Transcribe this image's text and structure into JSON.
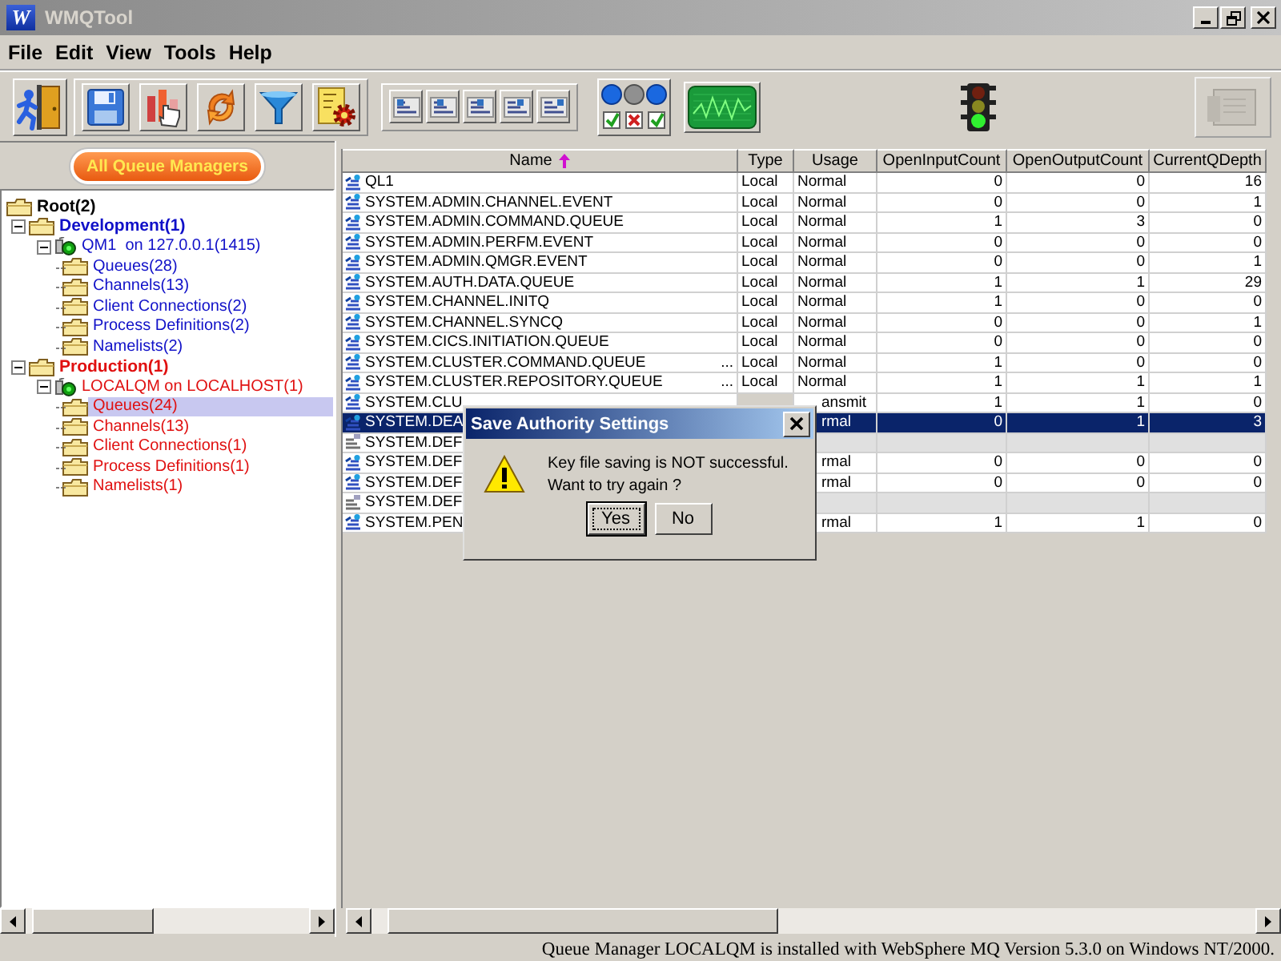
{
  "window": {
    "logo": "W",
    "title": "WMQTool"
  },
  "menu": [
    {
      "label": "File"
    },
    {
      "label": "Edit"
    },
    {
      "label": "View"
    },
    {
      "label": "Tools"
    },
    {
      "label": "Help"
    }
  ],
  "sidebar": {
    "button": "All Queue Managers",
    "tree": [
      {
        "label": "Root(2)",
        "kind": "folder",
        "selected": false,
        "children": [
          {
            "label": "Development(1)",
            "kind": "folder",
            "color": "#1010c8",
            "expanded": true,
            "selected": false,
            "children": [
              {
                "label": "QM1  on 127.0.0.1(1415)",
                "kind": "qmgr",
                "expanded": true,
                "selected": false,
                "children": [
                  {
                    "label": "Queues(28)",
                    "kind": "folder",
                    "selected": false
                  },
                  {
                    "label": "Channels(13)",
                    "kind": "folder",
                    "selected": false
                  },
                  {
                    "label": "Client Connections(2)",
                    "kind": "folder",
                    "selected": false
                  },
                  {
                    "label": "Process Definitions(2)",
                    "kind": "folder",
                    "selected": false
                  },
                  {
                    "label": "Namelists(2)",
                    "kind": "folder",
                    "selected": false
                  }
                ]
              }
            ]
          },
          {
            "label": "Production(1)",
            "kind": "folder",
            "color": "#e01010",
            "expanded": true,
            "selected": false,
            "children": [
              {
                "label": "LOCALQM on LOCALHOST(1)",
                "kind": "qmgr",
                "expanded": true,
                "selected": false,
                "children": [
                  {
                    "label": "Queues(24)",
                    "kind": "folder",
                    "selected": true
                  },
                  {
                    "label": "Channels(13)",
                    "kind": "folder",
                    "selected": false
                  },
                  {
                    "label": "Client Connections(1)",
                    "kind": "folder",
                    "selected": false
                  },
                  {
                    "label": "Process Definitions(1)",
                    "kind": "folder",
                    "selected": false
                  },
                  {
                    "label": "Namelists(1)",
                    "kind": "folder",
                    "selected": false
                  }
                ]
              }
            ]
          }
        ]
      }
    ]
  },
  "table": {
    "columns": [
      {
        "label": "Name",
        "sorted": true
      },
      {
        "label": "Type",
        "sorted": false
      },
      {
        "label": "Usage",
        "sorted": false
      },
      {
        "label": "OpenInputCount",
        "sorted": false
      },
      {
        "label": "OpenOutputCount",
        "sorted": false
      },
      {
        "label": "CurrentQDepth",
        "sorted": false
      }
    ],
    "rows": [
      {
        "kind": "queue",
        "selected": false,
        "obscured": false,
        "name": "QL1",
        "type": "Local",
        "usage": "Normal",
        "open_input": "0",
        "open_output": "0",
        "depth": "16"
      },
      {
        "kind": "queue",
        "selected": false,
        "obscured": false,
        "name": "SYSTEM.ADMIN.CHANNEL.EVENT",
        "type": "Local",
        "usage": "Normal",
        "open_input": "0",
        "open_output": "0",
        "depth": "1"
      },
      {
        "kind": "queue",
        "selected": false,
        "obscured": false,
        "name": "SYSTEM.ADMIN.COMMAND.QUEUE",
        "type": "Local",
        "usage": "Normal",
        "open_input": "1",
        "open_output": "3",
        "depth": "0"
      },
      {
        "kind": "queue",
        "selected": false,
        "obscured": false,
        "name": "SYSTEM.ADMIN.PERFM.EVENT",
        "type": "Local",
        "usage": "Normal",
        "open_input": "0",
        "open_output": "0",
        "depth": "0"
      },
      {
        "kind": "queue",
        "selected": false,
        "obscured": false,
        "name": "SYSTEM.ADMIN.QMGR.EVENT",
        "type": "Local",
        "usage": "Normal",
        "open_input": "0",
        "open_output": "0",
        "depth": "1"
      },
      {
        "kind": "queue",
        "selected": false,
        "obscured": false,
        "name": "SYSTEM.AUTH.DATA.QUEUE",
        "type": "Local",
        "usage": "Normal",
        "open_input": "1",
        "open_output": "1",
        "depth": "29"
      },
      {
        "kind": "queue",
        "selected": false,
        "obscured": false,
        "name": "SYSTEM.CHANNEL.INITQ",
        "type": "Local",
        "usage": "Normal",
        "open_input": "1",
        "open_output": "0",
        "depth": "0"
      },
      {
        "kind": "queue",
        "selected": false,
        "obscured": false,
        "name": "SYSTEM.CHANNEL.SYNCQ",
        "type": "Local",
        "usage": "Normal",
        "open_input": "0",
        "open_output": "0",
        "depth": "1"
      },
      {
        "kind": "queue",
        "selected": false,
        "obscured": false,
        "name": "SYSTEM.CICS.INITIATION.QUEUE",
        "type": "Local",
        "usage": "Normal",
        "open_input": "0",
        "open_output": "0",
        "depth": "0"
      },
      {
        "kind": "queue",
        "selected": false,
        "obscured": false,
        "name": "SYSTEM.CLUSTER.COMMAND.QUEUE",
        "suffix": "...",
        "type": "Local",
        "usage": "Normal",
        "open_input": "1",
        "open_output": "0",
        "depth": "0"
      },
      {
        "kind": "queue",
        "selected": false,
        "obscured": false,
        "name": "SYSTEM.CLUSTER.REPOSITORY.QUEUE",
        "suffix": "...",
        "type": "Local",
        "usage": "Normal",
        "open_input": "1",
        "open_output": "1",
        "depth": "1"
      },
      {
        "kind": "queue",
        "selected": false,
        "obscured": true,
        "name": "SYSTEM.CLU",
        "usage": "ansmit",
        "open_input": "1",
        "open_output": "1",
        "depth": "0"
      },
      {
        "kind": "queue",
        "selected": true,
        "obscured": true,
        "name": "SYSTEM.DEA",
        "usage": "rmal",
        "open_input": "0",
        "open_output": "1",
        "depth": "3"
      },
      {
        "kind": "model",
        "selected": false,
        "name": "SYSTEM.DEF"
      },
      {
        "kind": "queue",
        "selected": false,
        "obscured": true,
        "name": "SYSTEM.DEF",
        "usage": "rmal",
        "open_input": "0",
        "open_output": "0",
        "depth": "0"
      },
      {
        "kind": "queue",
        "selected": false,
        "obscured": true,
        "name": "SYSTEM.DEF",
        "usage": "rmal",
        "open_input": "0",
        "open_output": "0",
        "depth": "0"
      },
      {
        "kind": "model",
        "selected": false,
        "name": "SYSTEM.DEF"
      },
      {
        "kind": "queue",
        "selected": false,
        "obscured": true,
        "name": "SYSTEM.PEN",
        "usage": "rmal",
        "open_input": "1",
        "open_output": "1",
        "depth": "0"
      }
    ]
  },
  "dialog": {
    "title": "Save Authority Settings",
    "message": [
      "Key file saving is NOT successful.",
      "Want to try again ?"
    ],
    "buttons": [
      {
        "label": "Yes",
        "focused": true
      },
      {
        "label": "No",
        "focused": false
      }
    ]
  },
  "status_bar": "Queue Manager LOCALQM is installed with WebSphere MQ Version 5.3.0 on Windows NT/2000."
}
